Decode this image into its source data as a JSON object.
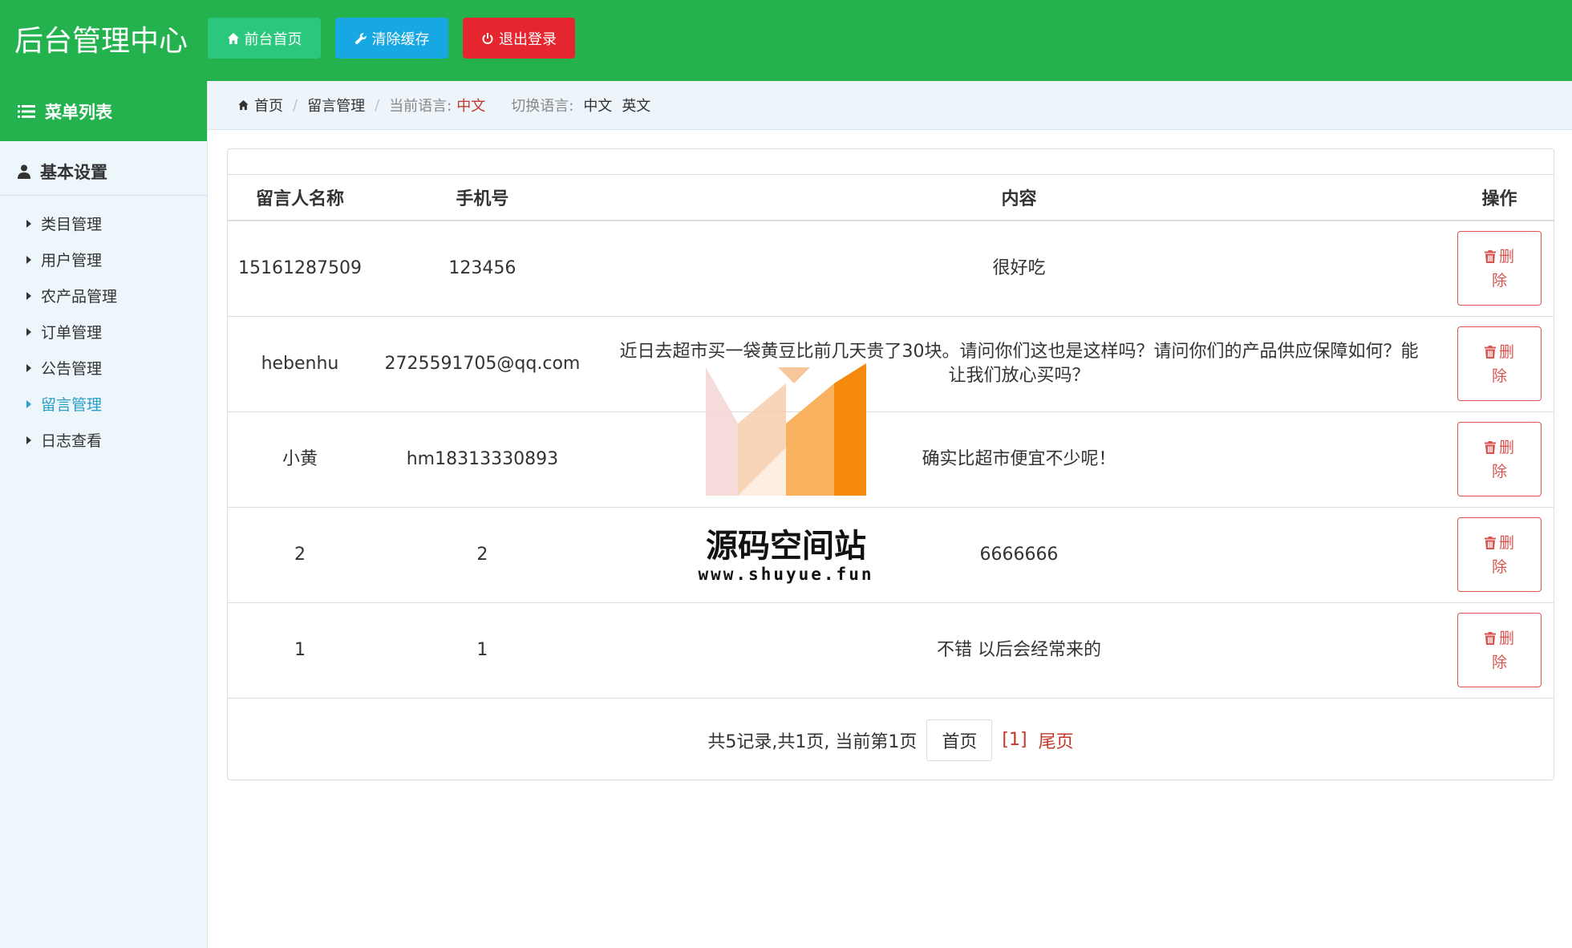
{
  "header": {
    "title": "后台管理中心",
    "buttons": {
      "home": "前台首页",
      "clear_cache": "清除缓存",
      "logout": "退出登录"
    }
  },
  "sidebar": {
    "menu_title": "菜单列表",
    "group_title": "基本设置",
    "items": [
      "类目管理",
      "用户管理",
      "农产品管理",
      "订单管理",
      "公告管理",
      "留言管理",
      "日志查看"
    ],
    "active_item": "留言管理"
  },
  "breadcrumb": {
    "home": "首页",
    "section": "留言管理",
    "current_lang_label": "当前语言:",
    "current_lang": "中文",
    "switch_lang_label": "切换语言:",
    "lang_zh": "中文",
    "lang_en": "英文"
  },
  "table": {
    "headers": {
      "name": "留言人名称",
      "phone": "手机号",
      "content": "内容",
      "action": "操作"
    },
    "rows": [
      {
        "name": "15161287509",
        "phone": "123456",
        "content": "很好吃"
      },
      {
        "name": "hebenhu",
        "phone": "2725591705@qq.com",
        "content": "近日去超市买一袋黄豆比前几天贵了30块。请问你们这也是这样吗？请问你们的产品供应保障如何？能让我们放心买吗？"
      },
      {
        "name": "小黄",
        "phone": "hm18313330893",
        "content": "确实比超市便宜不少呢！"
      },
      {
        "name": "2",
        "phone": "2",
        "content": "6666666"
      },
      {
        "name": "1",
        "phone": "1",
        "content": "不错 以后会经常来的"
      }
    ],
    "delete_label_line1": "删",
    "delete_label_line2": "除"
  },
  "pagination": {
    "info": "共5记录,共1页, 当前第1页",
    "first": "首页",
    "current": "[1]",
    "last": "尾页"
  },
  "watermark": {
    "title": "源码空间站",
    "url": "www.shuyue.fun"
  },
  "colors": {
    "header_green": "#24b24f",
    "home_btn": "#2ac77c",
    "cache_btn": "#17a8e3",
    "logout_btn": "#e5262f",
    "danger": "#d9534f",
    "active_link": "#2a9fc8"
  }
}
